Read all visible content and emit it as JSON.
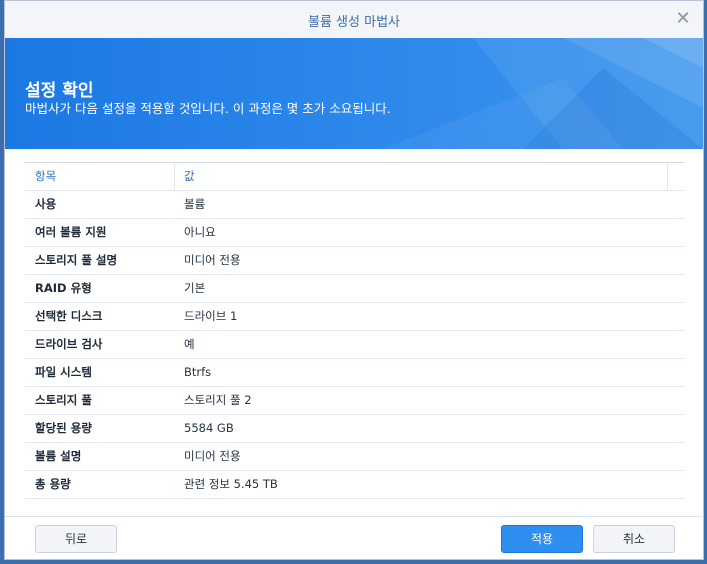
{
  "window": {
    "title": "볼륨 생성 마법사"
  },
  "banner": {
    "title": "설정 확인",
    "subtitle": "마법사가 다음 설정을 적용할 것입니다. 이 과정은 몇 초가 소요됩니다."
  },
  "table": {
    "headers": {
      "key": "항목",
      "value": "값"
    },
    "rows": [
      {
        "key": "사용",
        "value": "볼륨"
      },
      {
        "key": "여러 볼륨 지원",
        "value": "아니요"
      },
      {
        "key": "스토리지 풀 설명",
        "value": "미디어 전용"
      },
      {
        "key": "RAID 유형",
        "value": "기본"
      },
      {
        "key": "선택한 디스크",
        "value": "드라이브 1"
      },
      {
        "key": "드라이브 검사",
        "value": "예"
      },
      {
        "key": "파일 시스템",
        "value": "Btrfs"
      },
      {
        "key": "스토리지 풀",
        "value": "스토리지 풀 2"
      },
      {
        "key": "할당된 용량",
        "value": "5584 GB"
      },
      {
        "key": "볼륨 설명",
        "value": "미디어 전용"
      },
      {
        "key": "총 용량",
        "value": "관련 정보 5.45 TB"
      }
    ]
  },
  "footer": {
    "back_label": "뒤로",
    "apply_label": "적용",
    "cancel_label": "취소"
  },
  "icons": {
    "close": "close-icon"
  },
  "colors": {
    "accent": "#2e8ff0",
    "banner": "#1c78e3",
    "header_text": "#2f6fbf"
  }
}
